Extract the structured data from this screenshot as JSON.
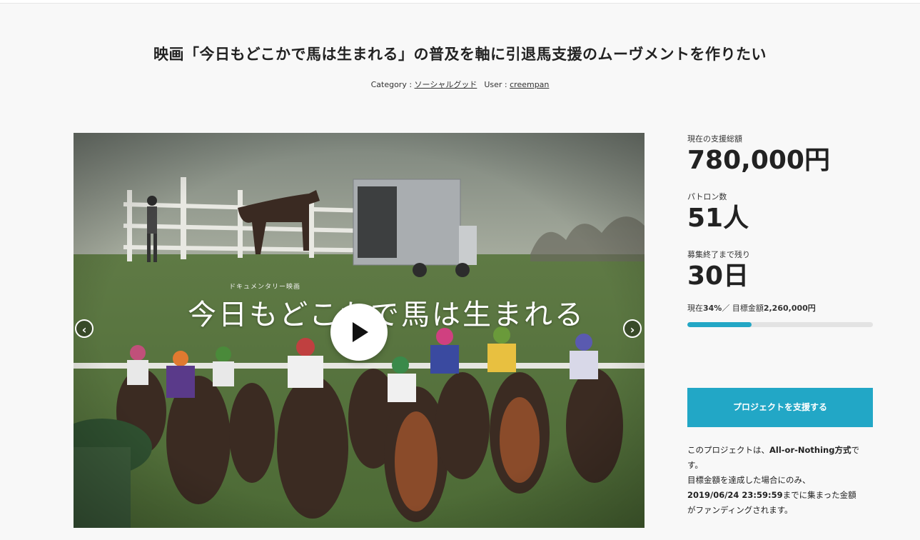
{
  "project": {
    "title": "映画「今日もどこかで馬は生まれる」の普及を軸に引退馬支援のムーヴメントを作りたい",
    "category_label": "Category : ",
    "category": "ソーシャルグッド",
    "user_label": "User : ",
    "user": "creempan"
  },
  "video": {
    "subtitle": "ドキュメンタリー映画",
    "title": "今日もどこかで馬は生まれる",
    "play_icon": "play-icon",
    "prev_icon": "chevron-left-icon",
    "next_icon": "chevron-right-icon"
  },
  "stats": {
    "total_label": "現在の支援総額",
    "total_value": "780,000円",
    "patrons_label": "パトロン数",
    "patrons_value": "51人",
    "remaining_label": "募集終了まで残り",
    "remaining_value": "30日",
    "progress_prefix": "現在",
    "progress_percent": "34%",
    "progress_sep": "／ 目標金額",
    "goal_amount": "2,260,000円",
    "progress_fraction": 0.345
  },
  "cta": {
    "label": "プロジェクトを支援する"
  },
  "note": {
    "line1_pre": "このプロジェクトは、",
    "line1_bold": "All-or-Nothing方式",
    "line1_post": "です。",
    "line2": "目標金額を達成した場合にのみ、",
    "line3_bold": "2019/06/24 23:59:59",
    "line3_post": "までに集まった金額",
    "line4": "がファンディングされます。"
  },
  "colors": {
    "accent": "#22a7c6",
    "background": "#f8f8f8",
    "bar_track": "#e3e3e3"
  }
}
